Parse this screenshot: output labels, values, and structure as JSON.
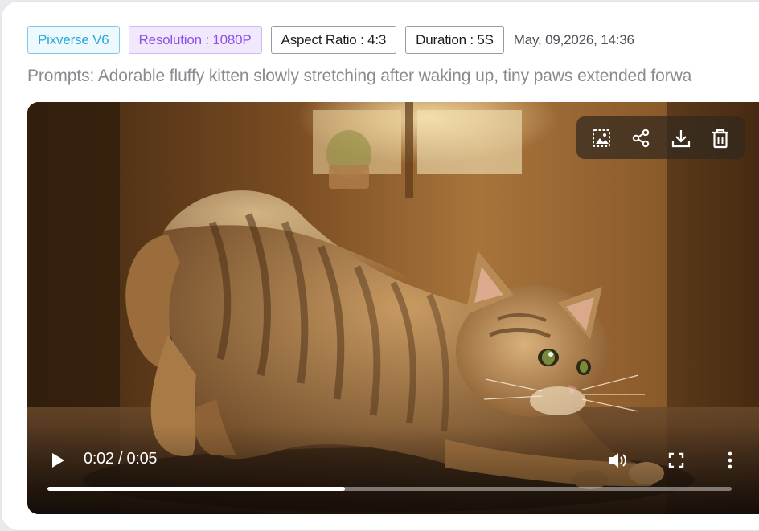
{
  "tags": {
    "model": "Pixverse V6",
    "resolution": "Resolution : 1080P",
    "aspect_ratio": "Aspect Ratio : 4:3",
    "duration": "Duration : 5S"
  },
  "timestamp": "May, 09,2026, 14:36",
  "prompt": "Prompts: Adorable fluffy kitten slowly stretching after waking up, tiny paws extended forwa",
  "video": {
    "actions": [
      "image-icon",
      "share-icon",
      "download-icon",
      "delete-icon"
    ],
    "current_time": "0:02",
    "separator": " / ",
    "duration": "0:05",
    "progress": 0.435
  },
  "colors": {
    "model_tag": "#29a8dc",
    "resolution_tag": "#8c53e6"
  }
}
